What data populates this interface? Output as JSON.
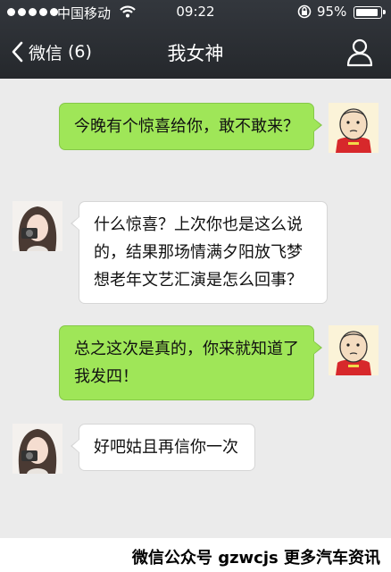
{
  "status_bar": {
    "carrier": "中国移动",
    "time": "09:22",
    "battery_percent": "95%",
    "battery_level": 0.95,
    "signal_bars": 5
  },
  "nav": {
    "back_label": "微信",
    "unread_count": "(6)",
    "title": "我女神"
  },
  "messages": [
    {
      "side": "outgoing",
      "text": "今晚有个惊喜给你，敢不敢来？"
    },
    {
      "side": "incoming",
      "text": "什么惊喜？上次你也是这么说的，结果那场情满夕阳放飞梦想老年文艺汇演是怎么回事？"
    },
    {
      "side": "outgoing",
      "text": "总之这次是真的，你来就知道了我发四！"
    },
    {
      "side": "incoming",
      "text": "好吧姑且再信你一次"
    }
  ],
  "watermark": "微信公众号 gzwcjs 更多汽车资讯",
  "colors": {
    "header_bg": "#2b2e33",
    "chat_bg": "#ebebeb",
    "outgoing_bubble": "#9fe658",
    "incoming_bubble": "#ffffff"
  },
  "icons": {
    "back": "chevron-left-icon",
    "profile": "person-icon",
    "wifi": "wifi-icon",
    "lock": "rotation-lock-icon",
    "battery": "battery-icon"
  }
}
